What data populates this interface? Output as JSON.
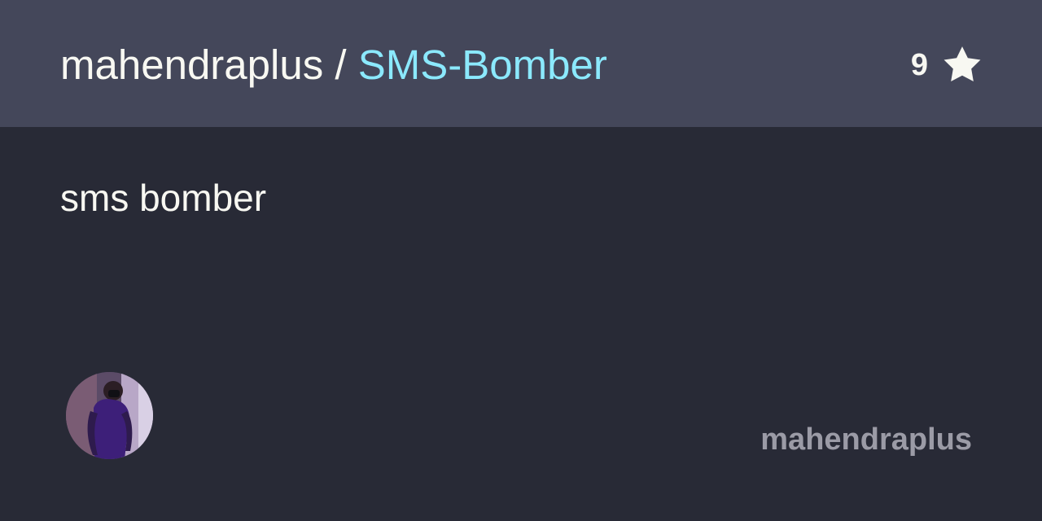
{
  "header": {
    "owner": "mahendraplus",
    "separator": "/",
    "repo_name": "SMS-Bomber",
    "star_count": "9",
    "star_icon": "star-icon"
  },
  "main": {
    "description": "sms bomber"
  },
  "footer": {
    "username": "mahendraplus",
    "avatar_icon": "avatar"
  },
  "colors": {
    "header_bg": "#44475a",
    "body_bg": "#282a36",
    "repo_name": "#8be9fd",
    "text": "#f8f8f2",
    "username": "#9b9ba6"
  }
}
